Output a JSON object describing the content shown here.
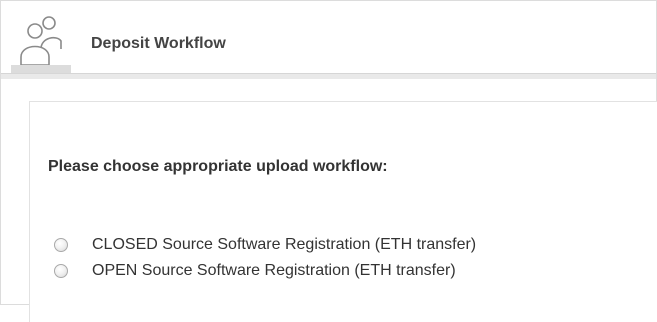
{
  "header": {
    "title": "Deposit Workflow",
    "icon": "users-icon"
  },
  "form": {
    "prompt": "Please choose appropriate upload workflow:",
    "options": [
      {
        "label": "CLOSED Source Software Registration (ETH transfer)",
        "selected": false
      },
      {
        "label": "OPEN Source Software Registration (ETH transfer)",
        "selected": false
      }
    ]
  }
}
